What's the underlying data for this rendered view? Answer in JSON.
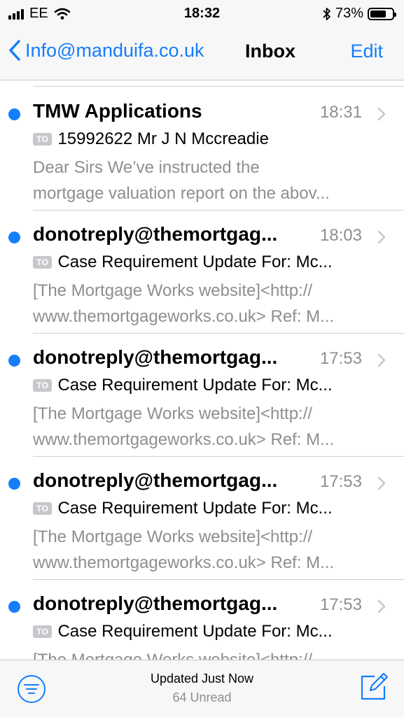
{
  "status_bar": {
    "carrier": "EE",
    "time": "18:32",
    "battery_percent": "73%",
    "battery_level": 0.73
  },
  "nav": {
    "back_label": "Info@manduifa.co.uk",
    "title": "Inbox",
    "edit_label": "Edit"
  },
  "badge_label": "TO",
  "messages": [
    {
      "sender": "TMW Applications",
      "time": "18:31",
      "subject": "15992622 Mr J N Mccreadie",
      "preview_1": "Dear Sirs We’ve instructed the",
      "preview_2": "mortgage valuation report on the abov..."
    },
    {
      "sender": "donotreply@themortgag...",
      "time": "18:03",
      "subject": "Case Requirement Update For:  Mc...",
      "preview_1": "[The Mortgage Works website]<http://",
      "preview_2": "www.themortgageworks.co.uk> Ref: M..."
    },
    {
      "sender": "donotreply@themortgag...",
      "time": "17:53",
      "subject": "Case Requirement Update For:  Mc...",
      "preview_1": "[The Mortgage Works website]<http://",
      "preview_2": "www.themortgageworks.co.uk> Ref: M..."
    },
    {
      "sender": "donotreply@themortgag...",
      "time": "17:53",
      "subject": "Case Requirement Update For:  Mc...",
      "preview_1": "[The Mortgage Works website]<http://",
      "preview_2": "www.themortgageworks.co.uk> Ref: M..."
    },
    {
      "sender": "donotreply@themortgag...",
      "time": "17:53",
      "subject": "Case Requirement Update For:  Mc...",
      "preview_1": "[The Mortgage Works website]<http://",
      "preview_2": ""
    }
  ],
  "toolbar": {
    "updated": "Updated Just Now",
    "unread": "64 Unread"
  },
  "colors": {
    "accent": "#147efb",
    "secondary_text": "#8e8e93"
  }
}
